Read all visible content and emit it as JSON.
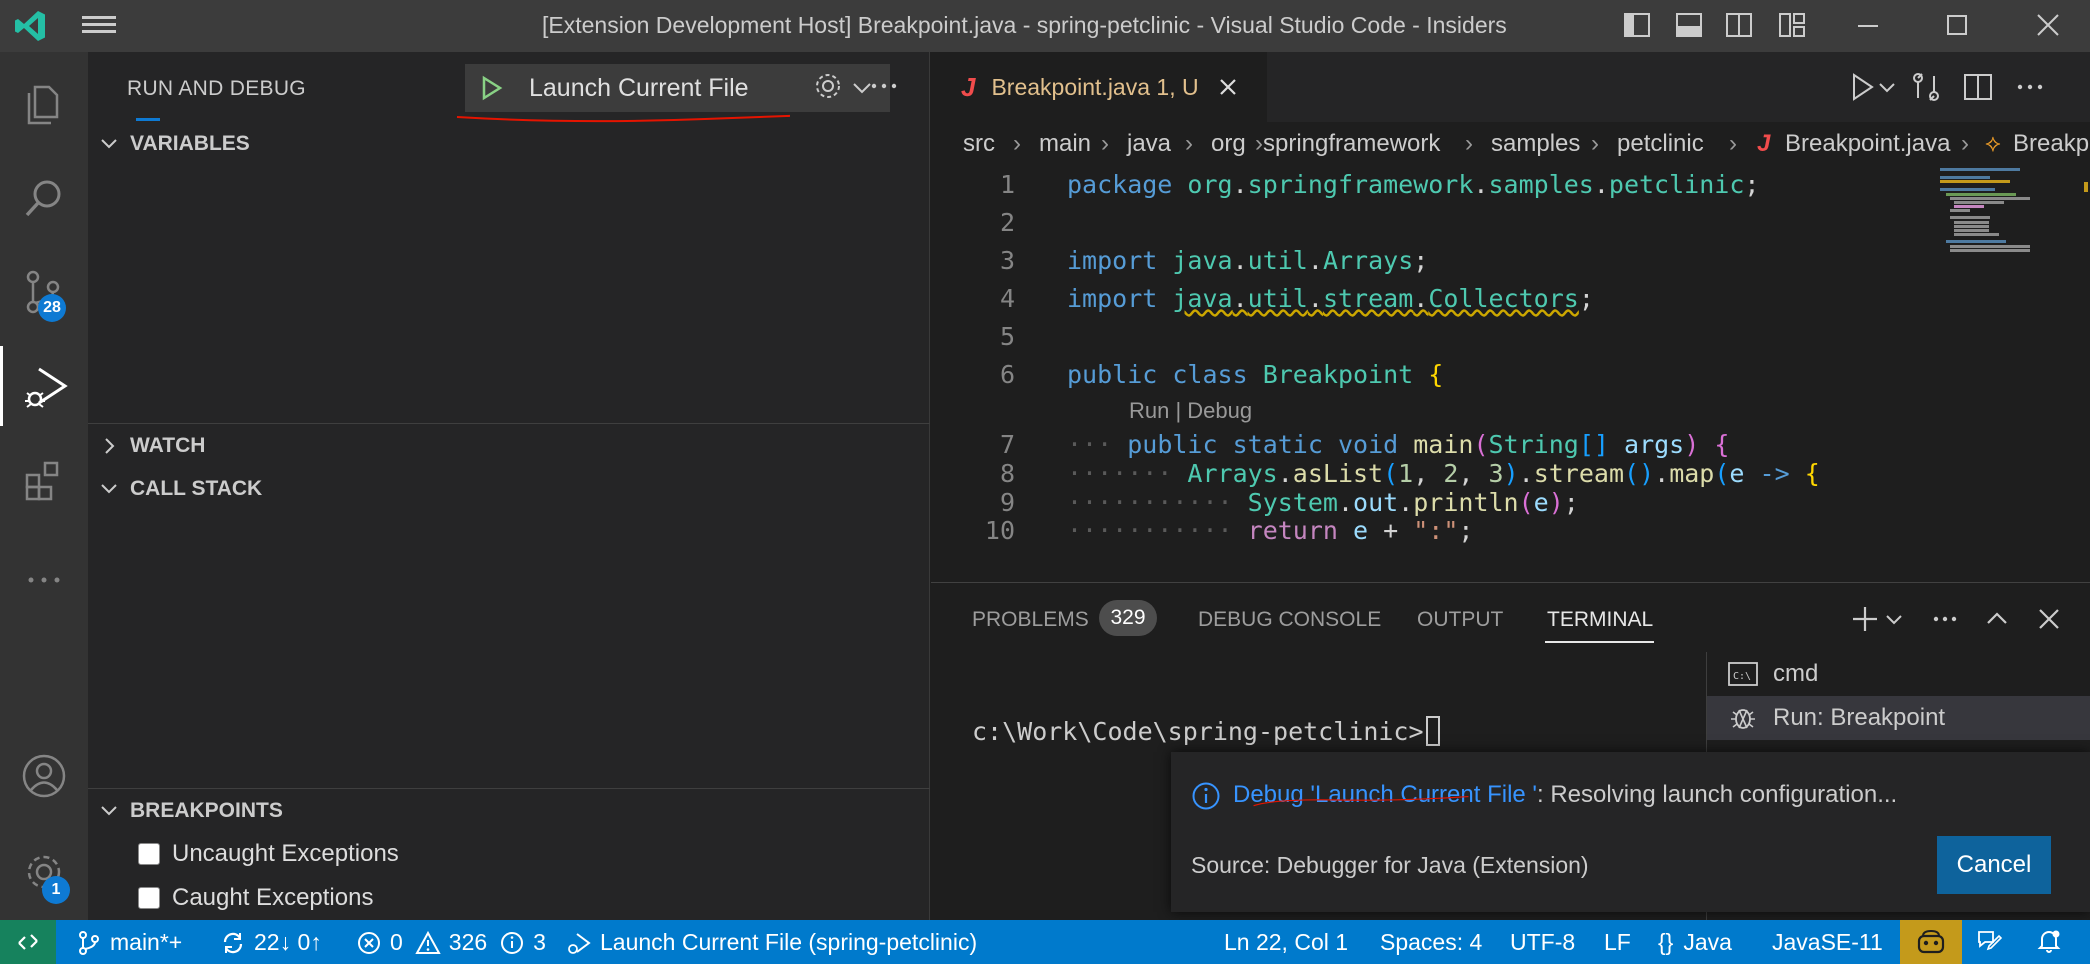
{
  "window": {
    "title": "[Extension Development Host] Breakpoint.java - spring-petclinic - Visual Studio Code - Insiders"
  },
  "activity": {
    "scm_badge": "28",
    "manage_badge": "1"
  },
  "sidebar": {
    "title": "RUN AND DEBUG",
    "launch_config": "Launch Current File",
    "sections": {
      "variables": "VARIABLES",
      "watch": "WATCH",
      "call_stack": "CALL STACK",
      "breakpoints": "BREAKPOINTS"
    },
    "breakpoint_items": [
      {
        "label": "Uncaught Exceptions",
        "checked": false
      },
      {
        "label": "Caught Exceptions",
        "checked": false
      }
    ]
  },
  "editor": {
    "tab": {
      "icon": "J",
      "name": "Breakpoint.java",
      "status": "1, U"
    },
    "breadcrumbs": [
      "src",
      "main",
      "java",
      "org",
      "springframework",
      "samples",
      "petclinic",
      "Breakpoint.java",
      "Breakpoint"
    ],
    "codelens": "Run | Debug",
    "lines": [
      "1",
      "2",
      "3",
      "4",
      "5",
      "6",
      "7",
      "8",
      "9",
      "10"
    ]
  },
  "panel": {
    "tabs": {
      "problems": "PROBLEMS",
      "problems_count": "329",
      "debug_console": "DEBUG CONSOLE",
      "output": "OUTPUT",
      "terminal": "TERMINAL"
    },
    "terminal_prompt": "c:\\Work\\Code\\spring-petclinic>",
    "terminals": [
      {
        "icon": "terminal-cmd-icon",
        "label": "cmd"
      },
      {
        "icon": "debug-icon",
        "label": "Run: Breakpoint"
      }
    ]
  },
  "notification": {
    "link": "Debug 'Launch Current File '",
    "message": ": Resolving launch configuration...",
    "source": "Source: Debugger for Java (Extension)",
    "cancel": "Cancel"
  },
  "statusbar": {
    "branch": "main*+",
    "sync": "22↓ 0↑",
    "errors": "0",
    "warnings": "326",
    "infos": "3",
    "launch": "Launch Current File (spring-petclinic)",
    "position": "Ln 22, Col 1",
    "spaces": "Spaces: 4",
    "encoding": "UTF-8",
    "eol": "LF",
    "language": "Java",
    "jdk": "JavaSE-11"
  },
  "colors": {
    "accent": "#007acc",
    "annotation": "#e51400"
  }
}
